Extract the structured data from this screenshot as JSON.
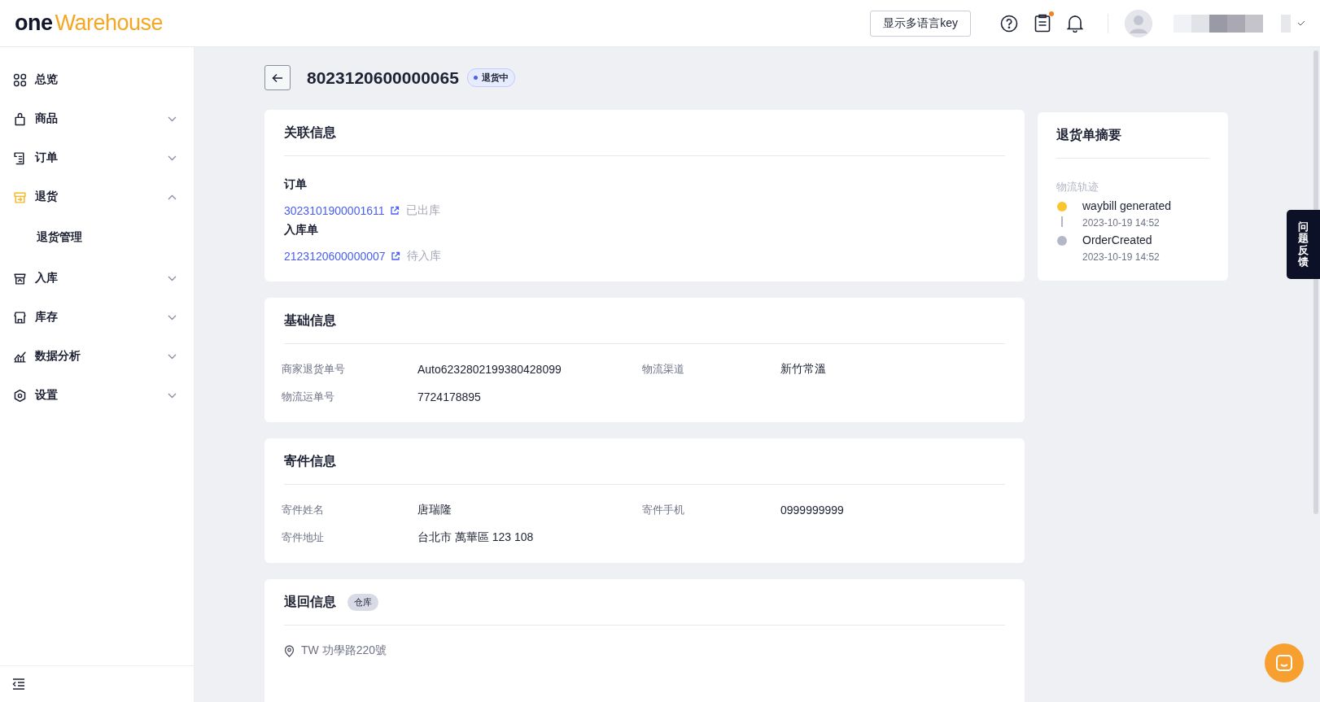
{
  "header": {
    "logo": {
      "prefix": "one",
      "name": "Warehouse"
    },
    "lang_button": "显示多语言key",
    "notifications_badge": true
  },
  "sidebar": {
    "items": [
      {
        "label": "总览",
        "kind": "link",
        "active": false
      },
      {
        "label": "商品",
        "kind": "group",
        "active": false,
        "expanded": false
      },
      {
        "label": "订单",
        "kind": "group",
        "active": false,
        "expanded": false
      },
      {
        "label": "退货",
        "kind": "group",
        "active": true,
        "expanded": true,
        "children": [
          {
            "label": "退货管理"
          }
        ]
      },
      {
        "label": "入库",
        "kind": "group",
        "active": false,
        "expanded": false
      },
      {
        "label": "库存",
        "kind": "group",
        "active": false,
        "expanded": false
      },
      {
        "label": "数据分析",
        "kind": "group",
        "active": false,
        "expanded": false
      },
      {
        "label": "设置",
        "kind": "group",
        "active": false,
        "expanded": false
      }
    ]
  },
  "page": {
    "title": "8023120600000065",
    "status": "退货中"
  },
  "related": {
    "title": "关联信息",
    "groups": [
      {
        "label": "订单",
        "number": "3023101900001611",
        "state": "已出库"
      },
      {
        "label": "入库单",
        "number": "2123120600000007",
        "state": "待入库"
      }
    ]
  },
  "basic": {
    "title": "基础信息",
    "fields": [
      {
        "label": "商家退货单号",
        "value": "Auto6232802199380428099"
      },
      {
        "label": "物流渠道",
        "value": "新竹常溫"
      },
      {
        "label": "物流运单号",
        "value": "7724178895"
      }
    ]
  },
  "sender": {
    "title": "寄件信息",
    "fields": [
      {
        "label": "寄件姓名",
        "value": "唐瑞隆"
      },
      {
        "label": "寄件手机",
        "value": "0999999999"
      },
      {
        "label": "寄件地址",
        "value": "台北市 萬華區 123 108"
      }
    ]
  },
  "return_info": {
    "title": "退回信息",
    "tag": "仓库",
    "address": "TW 功學路220號"
  },
  "summary": {
    "title": "退货单摘要",
    "section": "物流轨迹",
    "events": [
      {
        "title": "waybill generated",
        "time": "2023-10-19 14:52",
        "color": "#fbc52f"
      },
      {
        "title": "OrderCreated",
        "time": "2023-10-19 14:52",
        "color": "#b4b7c6"
      }
    ]
  },
  "feedback": "问题反馈"
}
